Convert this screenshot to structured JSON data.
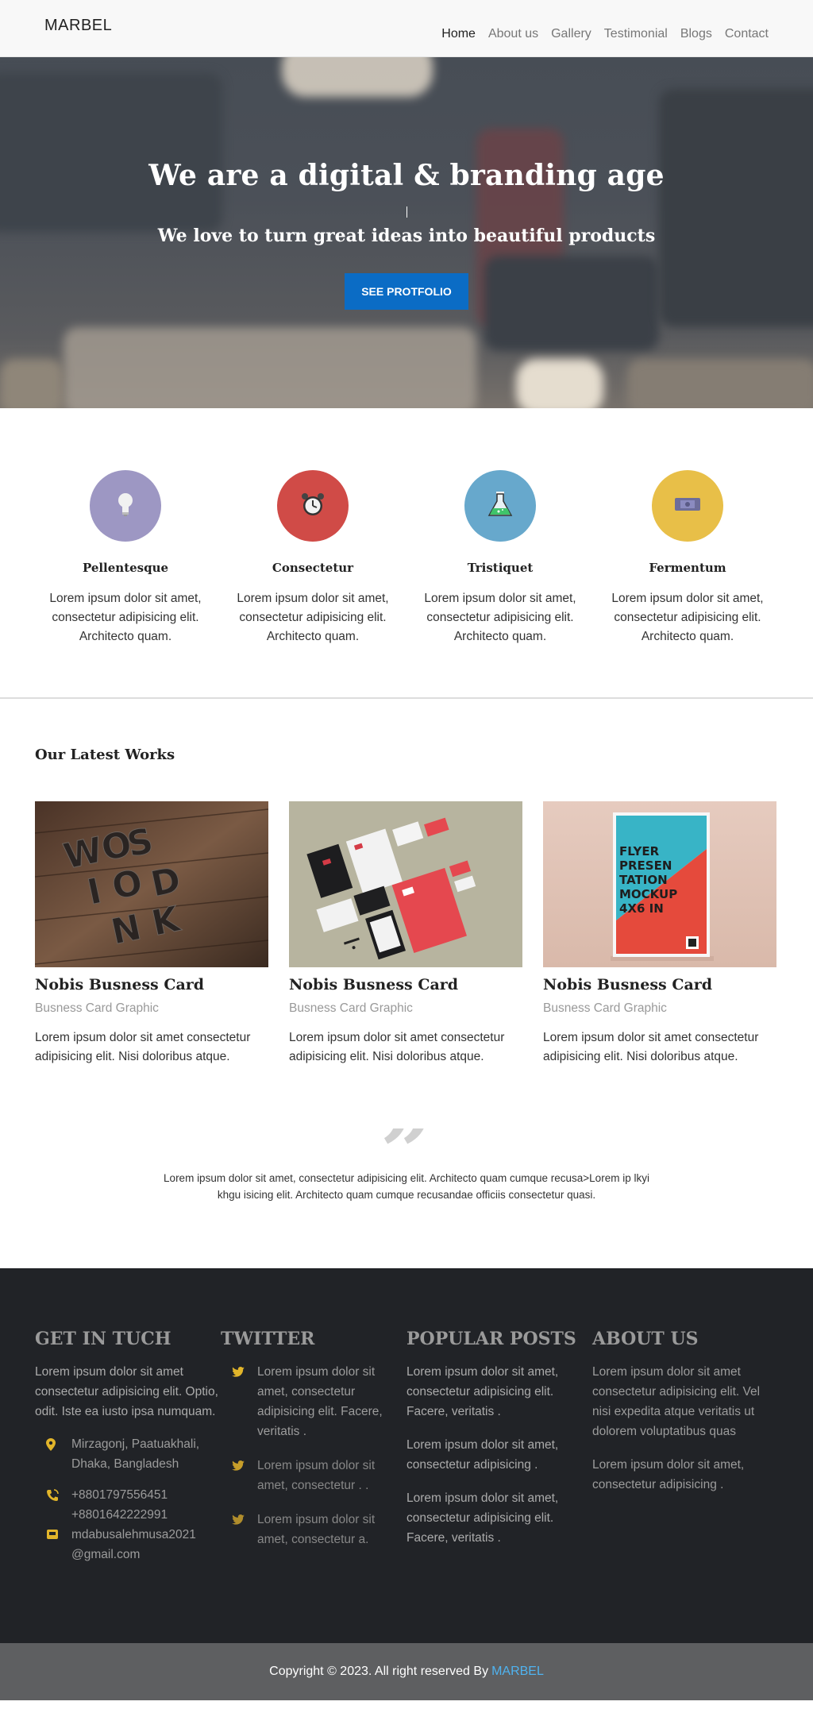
{
  "nav": {
    "brand": "MARBEL",
    "items": [
      {
        "label": "Home"
      },
      {
        "label": "About us"
      },
      {
        "label": "Gallery"
      },
      {
        "label": "Testimonial"
      },
      {
        "label": "Blogs"
      },
      {
        "label": "Contact"
      }
    ]
  },
  "hero": {
    "title": "We are a digital & branding age",
    "subtitle": "We love to turn great ideas into beautiful products",
    "button": "SEE PROTFOLIO"
  },
  "features": [
    {
      "title": "Pellentesque",
      "text": "Lorem ipsum dolor sit amet, consectetur adipisicing elit. Architecto quam.",
      "icon": "lightbulb-icon",
      "color": "#9d97c3"
    },
    {
      "title": "Consectetur",
      "text": "Lorem ipsum dolor sit amet, consectetur adipisicing elit. Architecto quam.",
      "icon": "alarm-clock-icon",
      "color": "#d04b47"
    },
    {
      "title": "Tristiquet",
      "text": "Lorem ipsum dolor sit amet, consectetur adipisicing elit. Architecto quam.",
      "icon": "flask-icon",
      "color": "#67a8cc"
    },
    {
      "title": "Fermentum",
      "text": "Lorem ipsum dolor sit amet, consectetur adipisicing elit. Architecto quam.",
      "icon": "ticket-icon",
      "color": "#e8bf48"
    }
  ],
  "works": {
    "heading": "Our Latest Works",
    "cards": [
      {
        "title": "Nobis Busness Card",
        "subtitle": "Busness Card Graphic",
        "text": "Lorem ipsum dolor sit amet consectetur adipisicing elit. Nisi doloribus atque.",
        "image": "wood-letters-image"
      },
      {
        "title": "Nobis Busness Card",
        "subtitle": "Busness Card Graphic",
        "text": "Lorem ipsum dolor sit amet consectetur adipisicing elit. Nisi doloribus atque.",
        "image": "stationery-mockup-image"
      },
      {
        "title": "Nobis Busness Card",
        "subtitle": "Busness Card Graphic",
        "text": "Lorem ipsum dolor sit amet consectetur adipisicing elit. Nisi doloribus atque.",
        "image": "flyer-mockup-image"
      }
    ],
    "flyer_text": "FLYER PRESEN TATION MOCKUP 4X6 IN"
  },
  "quote": {
    "mark": "”",
    "text": "Lorem ipsum dolor sit amet, consectetur adipisicing elit. Architecto quam cumque recusa>Lorem ip lkyi khgu isicing elit. Architecto quam cumque recusandae officiis consectetur quasi."
  },
  "footer": {
    "contact": {
      "heading": "GET IN TUCH",
      "text": "Lorem ipsum dolor sit amet consectetur adipisicing elit. Optio, odit. Iste ea iusto ipsa numquam.",
      "address": "Mirzagonj, Paatuakhali, Dhaka, Bangladesh",
      "phone1": "+8801797556451",
      "phone2": "+8801642222991",
      "email": "mdabusalehmusa2021 @gmail.com"
    },
    "twitter": {
      "heading": "TWITTER",
      "tweets": [
        "Lorem ipsum dolor sit amet, consectetur adipisicing elit. Facere, veritatis .",
        "Lorem ipsum dolor sit amet, consectetur . .",
        "Lorem ipsum dolor sit amet, consectetur a."
      ]
    },
    "posts": {
      "heading": "POPULAR POSTS",
      "items": [
        "Lorem ipsum dolor sit amet, consectetur adipisicing elit. Facere, veritatis .",
        "Lorem ipsum dolor sit amet, consectetur adipisicing .",
        "Lorem ipsum dolor sit amet, consectetur adipisicing elit. Facere, veritatis ."
      ]
    },
    "about": {
      "heading": "ABOUT US",
      "text1": "Lorem ipsum dolor sit amet consectetur adipisicing elit. Vel nisi expedita atque veritatis ut dolorem voluptatibus quas",
      "text2": "Lorem ipsum dolor sit amet, consectetur adipisicing ."
    }
  },
  "copyright": {
    "text": "Copyright © 2023. All right reserved By",
    "brand": "MARBEL"
  },
  "colors": {
    "accent": "#0b6cc5",
    "footer_bg": "#212327",
    "icon_yellow": "#e2b52a",
    "link_blue": "#4fb3f0"
  }
}
